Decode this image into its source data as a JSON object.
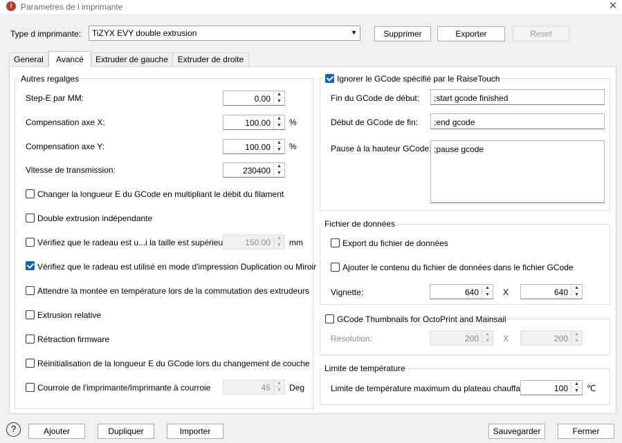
{
  "window": {
    "title": "Parametres de l imprimante",
    "close_glyph": "✕"
  },
  "printer_type": {
    "label": "Type d imprimante:",
    "value": "TiZYX EVY double extrusion",
    "buttons": {
      "delete": "Supprimer",
      "export": "Exporter",
      "reset": "Reset"
    }
  },
  "tabs": [
    "General",
    "Avancé",
    "Extruder de gauche",
    "Extruder de droite"
  ],
  "other_settings": {
    "title": "Autres regalges",
    "step_e": {
      "label": "Step-E par MM:",
      "value": "0.00"
    },
    "comp_x": {
      "label": "Compensation axe X:",
      "value": "100.00",
      "unit": "%"
    },
    "comp_y": {
      "label": "Compensation axe Y:",
      "value": "100.00",
      "unit": "%"
    },
    "baud": {
      "label": "Vitesse de transmission:",
      "value": "230400"
    },
    "checks": [
      {
        "label": "Changer la longueur E du GCode en multipliant le débit du filament",
        "checked": false
      },
      {
        "label": "Double extrusion indépendante",
        "checked": false
      },
      {
        "label": "Vérifiez que le radeau est u...i la taille est supérieure à",
        "checked": false
      },
      {
        "label": "Vérifiez que le radeau est utilisé en mode d'impression Duplication ou Miroir",
        "checked": true
      },
      {
        "label": "Attendre la montée en température lors de la commutation des extrudeurs",
        "checked": false
      },
      {
        "label": "Extrusion relative",
        "checked": false
      },
      {
        "label": "Rétraction firmware",
        "checked": false
      },
      {
        "label": "Réinitialisation de la longueur E du GCode lors du changement de couche",
        "checked": false
      },
      {
        "label": "Courroie de l'imprimante/Imprimante à courroie",
        "checked": false
      }
    ],
    "raft_size": {
      "value": "150.00",
      "unit": "mm"
    },
    "belt_angle": {
      "value": "45",
      "unit": "Deg"
    }
  },
  "gcode": {
    "ignore_label": "Ignorer le GCode spécifié par le RaiseTouch",
    "ignore_checked": true,
    "start_end": {
      "label": "Fin du GCode de début:",
      "value": ";start gcode finished"
    },
    "end_start": {
      "label": "Début de GCode de fin:",
      "value": ";end gcode"
    },
    "pause": {
      "label": "Pause à la hauteur GCode:",
      "value": ";pause gcode"
    }
  },
  "data_file": {
    "title": "Fichier de données",
    "export_label": "Export du fichier de données",
    "append_label": "Ajouter le contenu du fichier de données dans le fichier GCode",
    "thumb_label": "Vignette:",
    "thumb_w": "640",
    "x_sep": "X",
    "thumb_h": "640"
  },
  "octo": {
    "label": "GCode Thumbnails for OctoPrint and Mainsail",
    "res_label": "Résolution:",
    "res_w": "200",
    "x_sep": "X",
    "res_h": "200"
  },
  "temp_limit": {
    "title": "Limite de température",
    "label": "Limite de température maximum du plateau chauffant:",
    "value": "100",
    "unit": "℃"
  },
  "footer": {
    "help": "?",
    "add": "Ajouter",
    "duplicate": "Dupliquer",
    "import": "Importer",
    "save": "Sauvegarder",
    "close": "Fermer"
  }
}
